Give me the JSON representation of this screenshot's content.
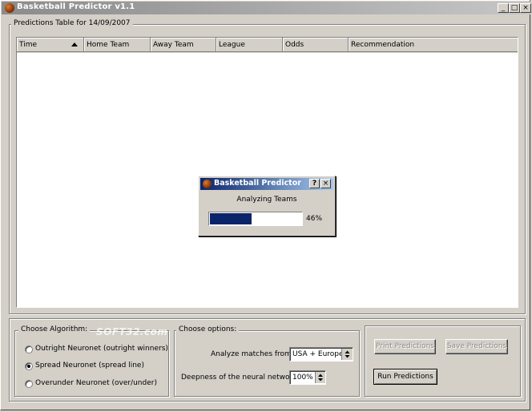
{
  "window": {
    "title": "Basketball Predictor v1.1",
    "controls": {
      "minimize": "_",
      "maximize": "□",
      "close": "×"
    }
  },
  "predictions": {
    "group_label": "Predictions Table for 14/09/2007",
    "columns": [
      "Time",
      "Home Team",
      "Away Team",
      "League",
      "Odds",
      "Recommendation"
    ],
    "sort_icon": "sort-ascending-arrow",
    "rows": []
  },
  "algorithm": {
    "group_label": "Choose Algorithm:",
    "options": [
      {
        "label": "Outright Neuronet  (outright winners)",
        "checked": false
      },
      {
        "label": "Spread Neuronet  (spread line)",
        "checked": true
      },
      {
        "label": "Overunder Neuronet  (over/under)",
        "checked": false
      }
    ]
  },
  "options": {
    "group_label": "Choose options:",
    "analyze_label": "Analyze matches from:",
    "analyze_value": "USA + Europe",
    "depth_label": "Deepness of the neural network:",
    "depth_value": "100%"
  },
  "actions": {
    "print_label": "Print Predictions",
    "save_label": "Save Predictions",
    "run_label": "Run Predictions"
  },
  "progress_dialog": {
    "title": "Basketball Predictor",
    "help": "?",
    "close": "×",
    "message": "Analyzing Teams",
    "percent_text": "46%",
    "progress": 0.46
  },
  "watermark": "SOFT32.com",
  "colors": {
    "face": "#d4d0c8",
    "dialog_title": "#0a246a",
    "progress_fill": "#0a246a"
  }
}
